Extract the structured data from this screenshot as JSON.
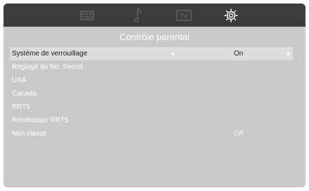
{
  "tabs": [
    {
      "icon": "picture-icon"
    },
    {
      "icon": "music-note-icon"
    },
    {
      "icon": "tv-icon"
    },
    {
      "icon": "settings-gear-icon",
      "active": true
    }
  ],
  "title": "Contrôle parental",
  "menu": {
    "items": [
      {
        "label": "Système de verrouillage",
        "value": "On"
      },
      {
        "label": "Réglage du No. Secret",
        "value": ""
      },
      {
        "label": "USA",
        "value": ""
      },
      {
        "label": "Canada",
        "value": ""
      },
      {
        "label": "RRT5",
        "value": ""
      },
      {
        "label": "Réinitialiser RRT5",
        "value": ""
      },
      {
        "label": "Non classé",
        "value": "Off"
      }
    ],
    "arrow_left": "◄",
    "arrow_right": "►"
  },
  "colors": {
    "panel_bg": "#c9c9c9",
    "topbar_bg": "#3c3c3c",
    "selected_bg": "#dcdcdc"
  }
}
